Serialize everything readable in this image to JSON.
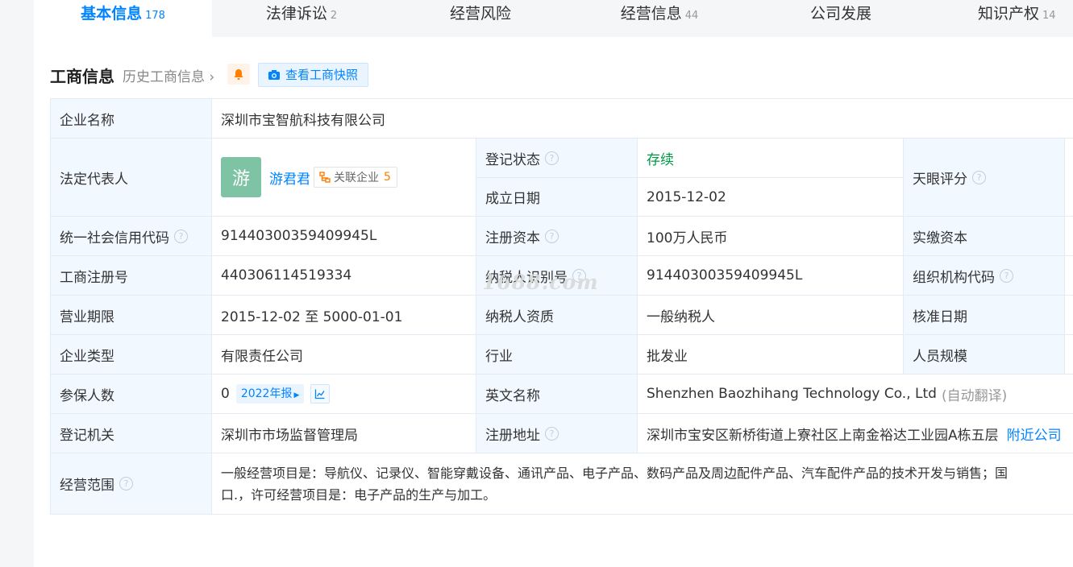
{
  "tabs": [
    {
      "label": "基本信息",
      "count": "178",
      "active": true
    },
    {
      "label": "法律诉讼",
      "count": "2"
    },
    {
      "label": "经营风险",
      "count": ""
    },
    {
      "label": "经营信息",
      "count": "44"
    },
    {
      "label": "公司发展",
      "count": ""
    },
    {
      "label": "知识产权",
      "count": "14"
    }
  ],
  "section": {
    "title": "工商信息",
    "history_link": "历史工商信息",
    "snapshot_button": "查看工商快照"
  },
  "company": {
    "name_label": "企业名称",
    "name_value": "深圳市宝智航科技有限公司",
    "rep_label": "法定代表人",
    "rep_avatar": "游",
    "rep_name": "游君君",
    "related_label": "关联企业",
    "related_count": "5",
    "status_label": "登记状态",
    "status_value": "存续",
    "founded_label": "成立日期",
    "founded_value": "2015-12-02",
    "score_label": "天眼评分",
    "credit_code_label": "统一社会信用代码",
    "credit_code_value": "91440300359409945L",
    "reg_capital_label": "注册资本",
    "reg_capital_value": "100万人民币",
    "paid_capital_label": "实缴资本",
    "reg_no_label": "工商注册号",
    "reg_no_value": "440306114519334",
    "taxpayer_id_label": "纳税人识别号",
    "taxpayer_id_value": "91440300359409945L",
    "org_code_label": "组织机构代码",
    "term_label": "营业期限",
    "term_value": "2015-12-02 至 5000-01-01",
    "tax_qual_label": "纳税人资质",
    "tax_qual_value": "一般纳税人",
    "approve_label": "核准日期",
    "type_label": "企业类型",
    "type_value": "有限责任公司",
    "industry_label": "行业",
    "industry_value": "批发业",
    "staff_label": "人员规模",
    "insured_label": "参保人数",
    "insured_value": "0",
    "report_tag": "2022年报",
    "en_name_label": "英文名称",
    "en_name_value": "Shenzhen Baozhihang Technology Co., Ltd",
    "en_name_note": "(自动翻译)",
    "authority_label": "登记机关",
    "authority_value": "深圳市市场监督管理局",
    "address_label": "注册地址",
    "address_value": "深圳市宝安区新桥街道上寮社区上南金裕达工业园A栋五层",
    "nearby_link": "附近公司",
    "scope_label": "经营范围",
    "scope_line1": "一般经营项目是：导航仪、记录仪、智能穿戴设备、通讯产品、电子产品、数码产品及周边配件产品、汽车配件产品的技术开发与销售；国",
    "scope_line2": "口.，许可经营项目是：电子产品的生产与加工。"
  },
  "watermark": "1688.com"
}
